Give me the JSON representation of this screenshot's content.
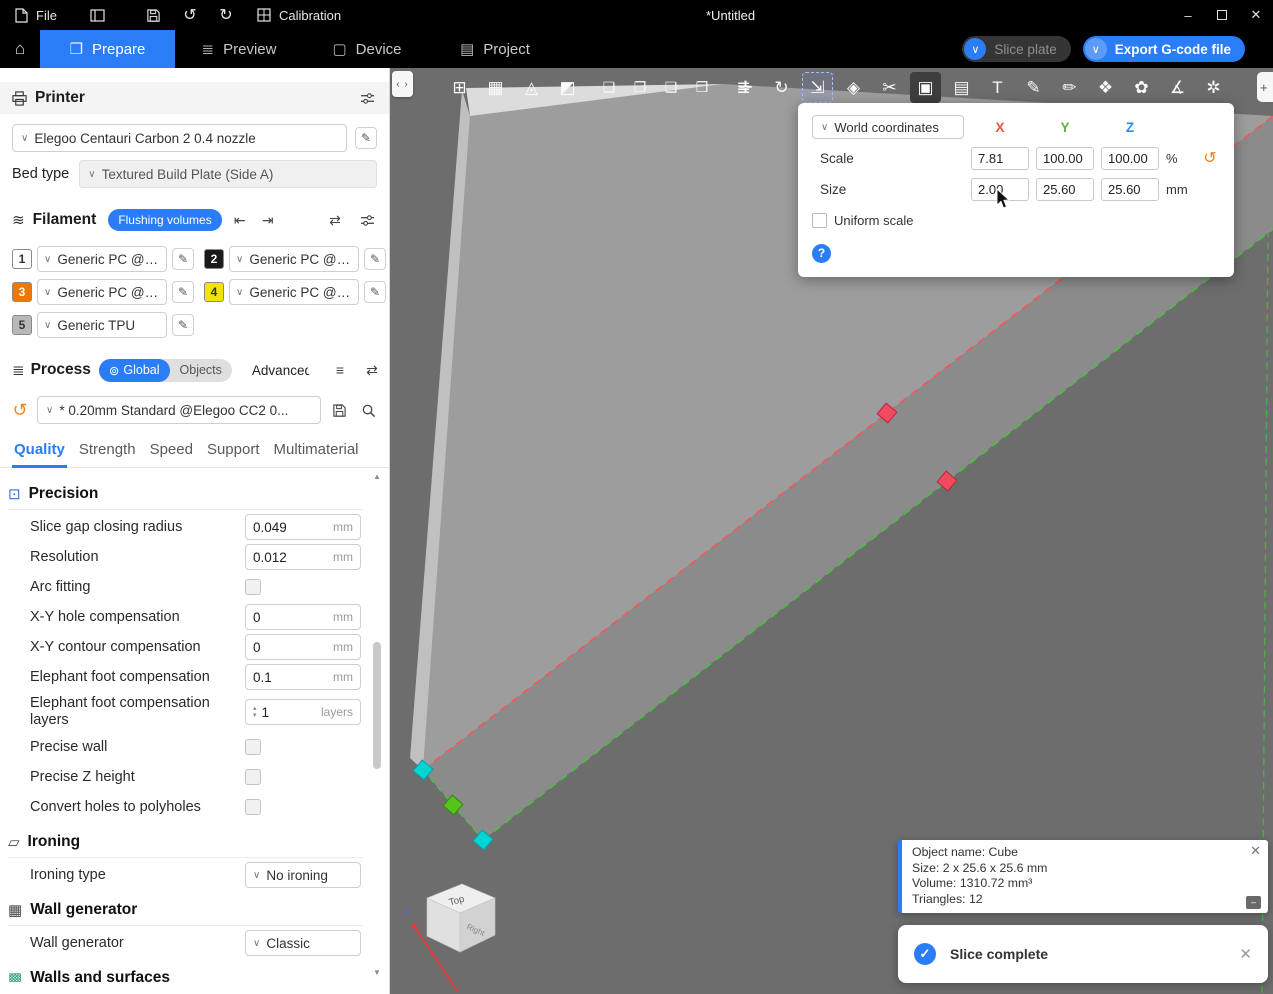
{
  "titlebar": {
    "file_label": "File",
    "calibration_label": "Calibration",
    "doc_title": "*Untitled",
    "minimize_glyph": "–",
    "close_glyph": "✕"
  },
  "nav": {
    "tabs": [
      {
        "label": "Prepare",
        "icon": "prepare-icon",
        "glyph": "❒"
      },
      {
        "label": "Preview",
        "icon": "preview-icon",
        "glyph": "≣"
      },
      {
        "label": "Device",
        "icon": "device-icon",
        "glyph": "▢"
      },
      {
        "label": "Project",
        "icon": "project-icon",
        "glyph": "▤"
      }
    ],
    "home_glyph": "⌂",
    "slice_button": "Slice plate",
    "export_button": "Export G-code file",
    "chevron": "∨"
  },
  "printer": {
    "title": "Printer",
    "name": "Elegoo Centauri Carbon 2 0.4 nozzle",
    "bed_type_label": "Bed type",
    "bed_type": "Textured Build Plate (Side A)"
  },
  "filament": {
    "title": "Filament",
    "flushing_button": "Flushing volumes",
    "slots": [
      {
        "num": "1",
        "color": "#ffffff",
        "text_color": "#333333",
        "name": "Generic PC @E..."
      },
      {
        "num": "2",
        "color": "#1a1a1a",
        "text_color": "#ffffff",
        "name": "Generic PC @Ele..."
      },
      {
        "num": "3",
        "color": "#f07800",
        "text_color": "#ffffff",
        "name": "Generic PC @E..."
      },
      {
        "num": "4",
        "color": "#f2e400",
        "text_color": "#333333",
        "name": "Generic PC @Ele..."
      },
      {
        "num": "5",
        "color": "#b8b8b8",
        "text_color": "#333333",
        "name": "Generic TPU"
      }
    ]
  },
  "process": {
    "title": "Process",
    "global_label": "Global",
    "objects_label": "Objects",
    "advanced_label": "Advanced",
    "preset": "* 0.20mm Standard @Elegoo CC2 0...",
    "tabs": [
      "Quality",
      "Strength",
      "Speed",
      "Support",
      "Multimaterial"
    ],
    "active_tab": "Quality"
  },
  "settings": {
    "sections": {
      "precision": "Precision",
      "ironing": "Ironing",
      "wall_generator": "Wall generator",
      "walls_surfaces": "Walls and surfaces"
    },
    "rows": {
      "slice_gap": {
        "label": "Slice gap closing radius",
        "value": "0.049",
        "unit": "mm"
      },
      "resolution": {
        "label": "Resolution",
        "value": "0.012",
        "unit": "mm"
      },
      "arc_fitting": {
        "label": "Arc fitting"
      },
      "xy_hole": {
        "label": "X-Y hole compensation",
        "value": "0",
        "unit": "mm"
      },
      "xy_contour": {
        "label": "X-Y contour compensation",
        "value": "0",
        "unit": "mm"
      },
      "elephant_foot": {
        "label": "Elephant foot compensation",
        "value": "0.1",
        "unit": "mm"
      },
      "elephant_layers": {
        "label": "Elephant foot compensation layers",
        "value": "1",
        "unit": "layers"
      },
      "precise_wall": {
        "label": "Precise wall"
      },
      "precise_z": {
        "label": "Precise Z height"
      },
      "polyholes": {
        "label": "Convert holes to polyholes"
      },
      "ironing_type": {
        "label": "Ironing type",
        "value": "No ironing"
      },
      "wall_generator": {
        "label": "Wall generator",
        "value": "Classic"
      }
    }
  },
  "viewport": {
    "toolbar_left": [
      {
        "name": "add-model",
        "glyph": "⊞"
      },
      {
        "name": "arrange",
        "glyph": "▦"
      },
      {
        "name": "auto-orient",
        "glyph": "◬"
      },
      {
        "name": "seam-position",
        "glyph": "◩"
      },
      {
        "name": "split-to-objects",
        "glyph": "❏"
      },
      {
        "name": "split-to-parts",
        "glyph": "❐"
      },
      {
        "name": "clone",
        "glyph": "❑"
      },
      {
        "name": "fill-plate",
        "glyph": "❒"
      },
      {
        "name": "layers",
        "glyph": "≣"
      }
    ],
    "toolbar_right": [
      {
        "name": "move",
        "glyph": "✛"
      },
      {
        "name": "rotate",
        "glyph": "↻"
      },
      {
        "name": "scale",
        "glyph": "⇲"
      },
      {
        "name": "flatten",
        "glyph": "◈"
      },
      {
        "name": "cut",
        "glyph": "✂"
      },
      {
        "name": "mesh-boolean",
        "glyph": "▣"
      },
      {
        "name": "variable-layer-height",
        "glyph": "▤"
      },
      {
        "name": "text",
        "glyph": "T"
      },
      {
        "name": "svg-tool",
        "glyph": "✎"
      },
      {
        "name": "seam-painting",
        "glyph": "✏"
      },
      {
        "name": "support-painting",
        "glyph": "❖"
      },
      {
        "name": "color-painting",
        "glyph": "✿"
      },
      {
        "name": "measure",
        "glyph": "∡"
      },
      {
        "name": "assembly-view",
        "glyph": "✲"
      }
    ],
    "gizmo": {
      "coord_mode": "World coordinates",
      "axes": [
        {
          "label": "X",
          "color": "#e8573f"
        },
        {
          "label": "Y",
          "color": "#62b33e"
        },
        {
          "label": "Z",
          "color": "#2a8cf0"
        }
      ],
      "scale_label": "Scale",
      "scale_x": "7.81",
      "scale_y": "100.00",
      "scale_z": "100.00",
      "scale_unit": "%",
      "size_label": "Size",
      "size_x": "2.00",
      "size_y": "25.60",
      "size_z": "25.60",
      "size_unit": "mm",
      "uniform_label": "Uniform scale",
      "help_glyph": "?"
    },
    "object_info": {
      "line1": "Object name: Cube",
      "line2": "Size: 2 x 25.6 x 25.6 mm",
      "line3": "Volume: 1310.72 mm³",
      "line4": "Triangles: 12"
    },
    "toast": {
      "message": "Slice complete",
      "check_glyph": "✓"
    },
    "navcube": {
      "top": "Top",
      "right": "Right",
      "z": "z"
    }
  },
  "colors": {
    "accent": "#2a7cf7",
    "viewport_bg": "#6d6d6d",
    "object_face": "#9d9d9d",
    "handle_red": "#f04a5e",
    "handle_cyan": "#00d5d5",
    "handle_green": "#52c41a"
  }
}
